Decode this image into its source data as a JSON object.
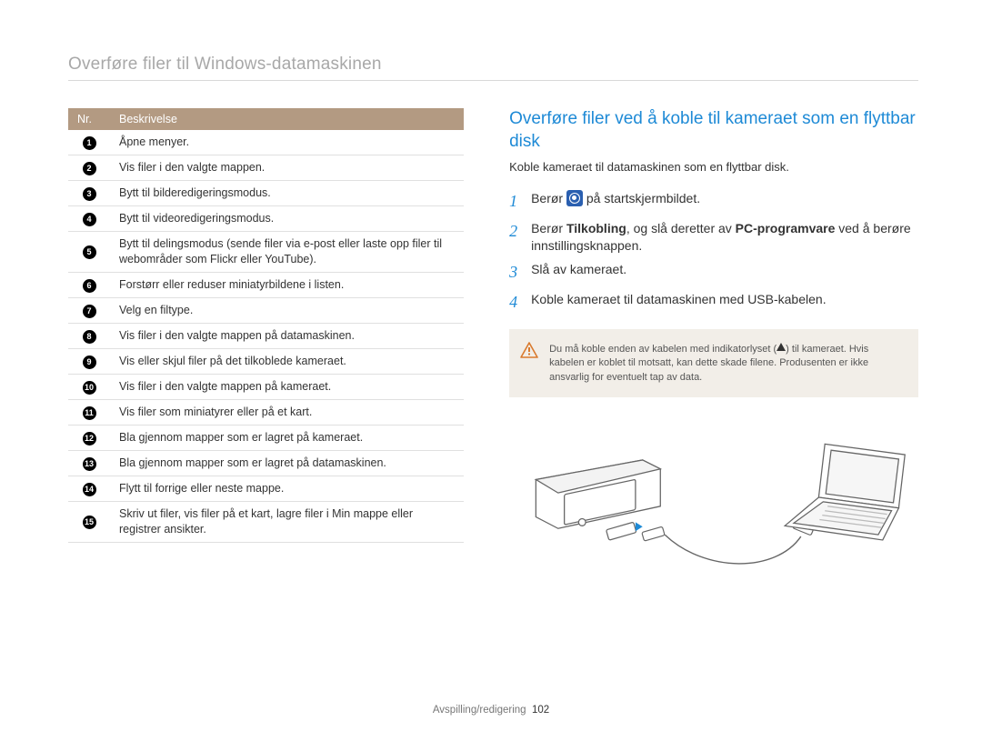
{
  "page_title": "Overføre filer til Windows-datamaskinen",
  "table": {
    "header_nr": "Nr.",
    "header_desc": "Beskrivelse",
    "rows": [
      "Åpne menyer.",
      "Vis filer i den valgte mappen.",
      "Bytt til bilderedigeringsmodus.",
      "Bytt til videoredigeringsmodus.",
      "Bytt til delingsmodus (sende filer via e-post eller laste opp filer til webområder som Flickr eller YouTube).",
      "Forstørr eller reduser miniatyrbildene i listen.",
      "Velg en filtype.",
      "Vis filer i den valgte mappen på datamaskinen.",
      "Vis eller skjul filer på det tilkoblede kameraet.",
      "Vis filer i den valgte mappen på kameraet.",
      "Vis filer som miniatyrer eller på et kart.",
      "Bla gjennom mapper som er lagret på kameraet.",
      "Bla gjennom mapper som er lagret på datamaskinen.",
      "Flytt til forrige eller neste mappe.",
      "Skriv ut filer, vis filer på et kart, lagre filer i Min mappe eller registrer ansikter."
    ]
  },
  "section_title": "Overføre filer ved å koble til kameraet som en flyttbar disk",
  "intro": "Koble kameraet til datamaskinen som en flyttbar disk.",
  "steps": {
    "s1_before": "Berør ",
    "s1_after": " på startskjermbildet.",
    "s2_a": "Berør ",
    "s2_bold1": "Tilkobling",
    "s2_b": ", og slå deretter av ",
    "s2_bold2": "PC-programvare",
    "s2_c": " ved å berøre innstillingsknappen.",
    "s3": "Slå av kameraet.",
    "s4": "Koble kameraet til datamaskinen med USB-kabelen."
  },
  "note": {
    "line1a": "Du må koble enden av kabelen med indikatorlyset (",
    "line1b": ") til kameraet. Hvis kabelen er koblet til motsatt, kan dette skade filene. Produsenten er ikke ansvarlig for eventuelt tap av data."
  },
  "footer": {
    "section": "Avspilling/redigering",
    "page_number": "102"
  }
}
